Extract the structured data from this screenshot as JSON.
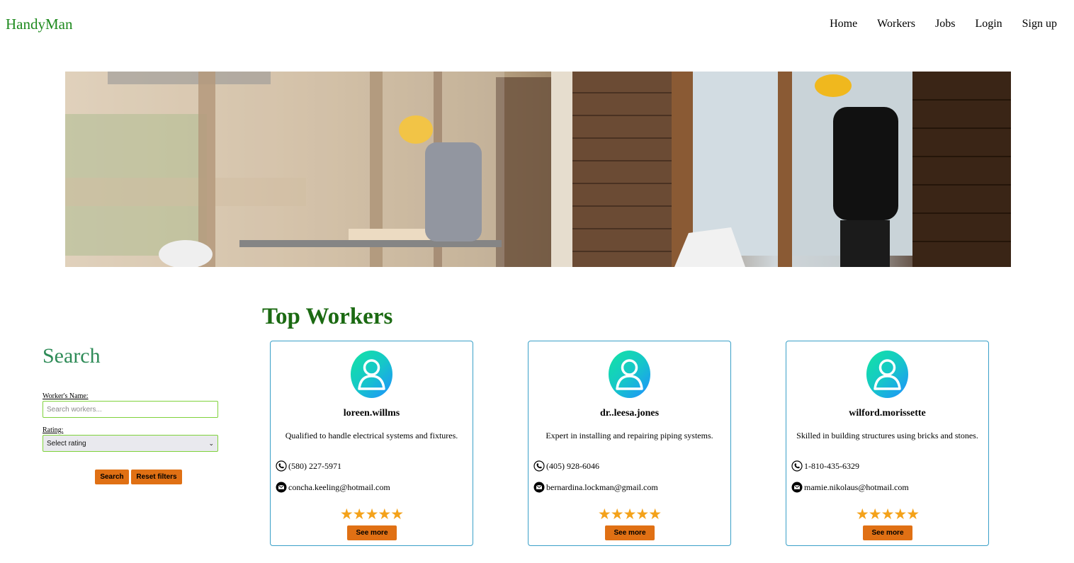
{
  "brand": "HandyMan",
  "nav": [
    "Home",
    "Workers",
    "Jobs",
    "Login",
    "Sign up"
  ],
  "search": {
    "title": "Search",
    "name_label": "Worker's Name:",
    "name_placeholder": "Search workers...",
    "rating_label": "Rating:",
    "rating_selected": "Select rating",
    "search_button": "Search",
    "reset_button": "Reset filters"
  },
  "top_workers": {
    "title": "Top Workers",
    "see_more": "See more",
    "stars": "★★★★★",
    "rating": 5,
    "cards": [
      {
        "name": "loreen.willms",
        "desc": "Qualified to handle electrical systems and fixtures.",
        "phone": "(580) 227-5971",
        "email": "concha.keeling@hotmail.com"
      },
      {
        "name": "dr..leesa.jones",
        "desc": "Expert in installing and repairing piping systems.",
        "phone": "(405) 928-6046",
        "email": "bernardina.lockman@gmail.com"
      },
      {
        "name": "wilford.morissette",
        "desc": "Skilled in building structures using bricks and stones.",
        "phone": "1-810-435-6329",
        "email": "mamie.nikolaus@hotmail.com"
      }
    ]
  },
  "colors": {
    "accent_green": "#1e8a1e",
    "button_orange": "#e07014",
    "card_border": "#3aa0c8"
  }
}
